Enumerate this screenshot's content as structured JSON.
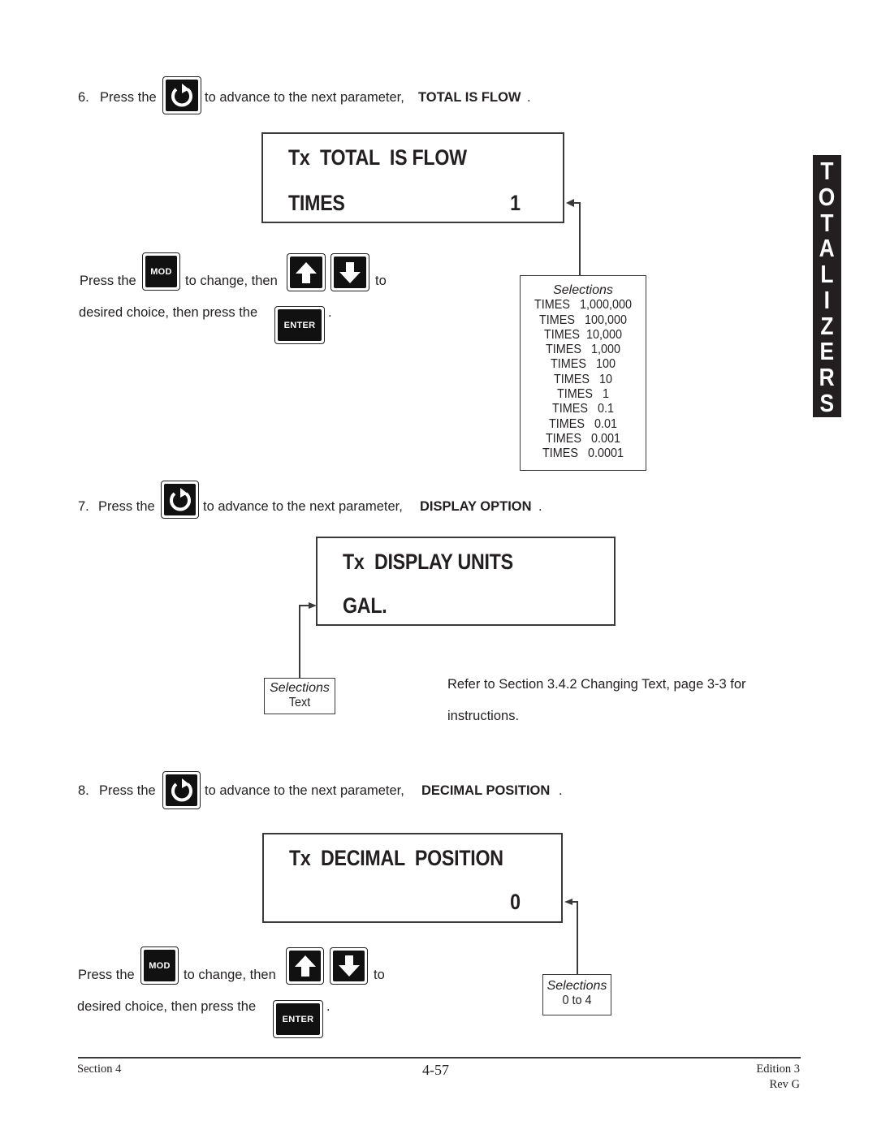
{
  "side_tab": {
    "letters": [
      "T",
      "O",
      "T",
      "A",
      "L",
      "I",
      "Z",
      "E",
      "R",
      "S"
    ]
  },
  "keys": {
    "advance_icon": "circular-arrow-icon",
    "mod_label": "MOD",
    "enter_label": "ENTER",
    "up_icon": "up-arrow-icon",
    "down_icon": "down-arrow-icon"
  },
  "step6": {
    "number": "6.",
    "press_the": "Press the",
    "advance_text": "to advance to the next parameter,",
    "param_name": "TOTAL IS FLOW",
    "period": ".",
    "display": {
      "line1": "Tx  TOTAL  IS FLOW",
      "line2": "TIMES",
      "value": "1"
    },
    "instr": {
      "press_the": "Press the",
      "to_change_then": "to change, then",
      "to": "to",
      "desired_choice": "desired choice, then press the",
      "period": "."
    },
    "selections": {
      "header": "Selections",
      "items": [
        "TIMES   1,000,000",
        "TIMES   100,000",
        "TIMES  10,000",
        "TIMES   1,000",
        "TIMES   100",
        "TIMES   10",
        "TIMES   1",
        "TIMES   0.1",
        "TIMES   0.01",
        "TIMES   0.001",
        "TIMES   0.0001"
      ]
    }
  },
  "step7": {
    "number": "7.",
    "press_the": "Press the",
    "advance_text": "to advance to the next parameter,",
    "param_name": "DISPLAY OPTION",
    "period": ".",
    "display": {
      "line1": "Tx  DISPLAY UNITS",
      "line2": "GAL."
    },
    "selections": {
      "header": "Selections",
      "items": [
        "Text"
      ]
    },
    "refer_line1": "Refer to Section 3.4.2 Changing Text, page 3-3 for",
    "refer_line2": "instructions."
  },
  "step8": {
    "number": "8.",
    "press_the": "Press the",
    "advance_text": "to advance to the next parameter,",
    "param_name": "DECIMAL POSITION",
    "period": ".",
    "display": {
      "line1": "Tx  DECIMAL  POSITION",
      "value": "0"
    },
    "instr": {
      "press_the": "Press the",
      "to_change_then": "to change, then",
      "to": "to",
      "desired_choice": "desired choice, then press the",
      "period": "."
    },
    "selections": {
      "header": "Selections",
      "items": [
        "0 to 4"
      ]
    }
  },
  "footer": {
    "section": "Section 4",
    "page": "4-57",
    "edition": "Edition 3",
    "rev": "Rev G"
  }
}
